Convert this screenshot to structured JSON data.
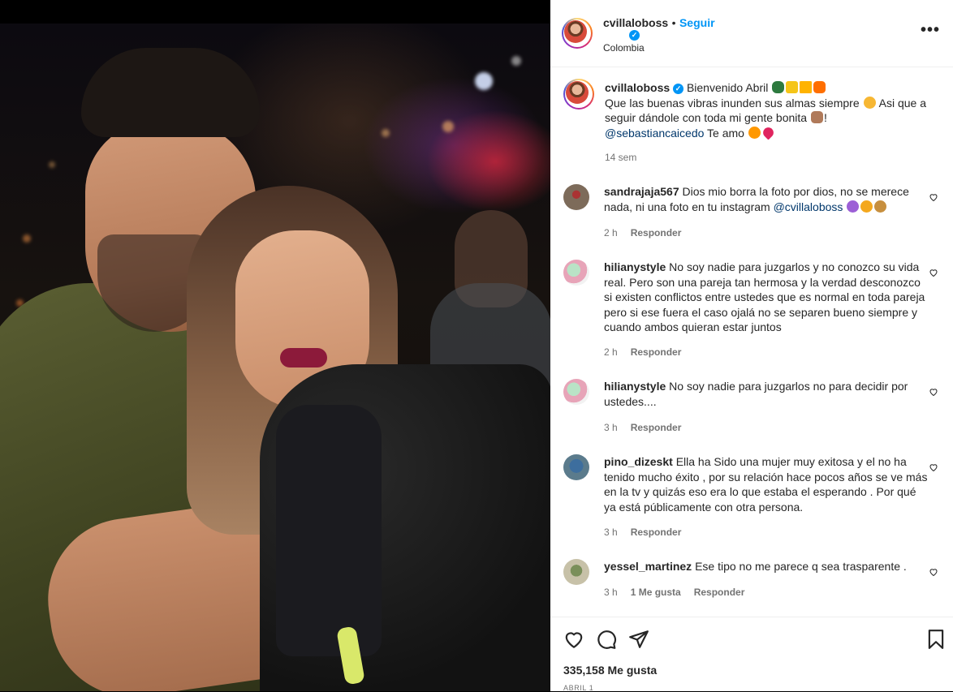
{
  "post": {
    "username": "cvillaloboss",
    "follow_label": "Seguir",
    "separator": "•",
    "location": "Colombia",
    "more_label": "•••"
  },
  "caption": {
    "username": "cvillaloboss",
    "line1": "Bienvenido Abril",
    "line2": "Que las buenas vibras inunden sus almas siempre",
    "line3": "Asi que a seguir dándole con toda mi gente bonita",
    "line4_end": "!",
    "mention": "@sebastiancaicedo",
    "ending": "Te amo",
    "time": "14 sem"
  },
  "comments": [
    {
      "username": "sandrajaja567",
      "text": "Dios mio borra la foto por dios, no se merece nada, ni una foto en tu instagram",
      "mention": "@cvillaloboss",
      "time": "2 h",
      "reply": "Responder",
      "likes": ""
    },
    {
      "username": "hilianystyle",
      "text": "No soy nadie para juzgarlos y no conozco su vida real. Pero son una pareja tan hermosa y la verdad desconozco si existen conflictos entre ustedes que es normal en toda pareja pero si ese fuera el caso ojalá no se separen bueno siempre y cuando ambos quieran estar juntos",
      "mention": "",
      "time": "2 h",
      "reply": "Responder",
      "likes": ""
    },
    {
      "username": "hilianystyle",
      "text": "No soy nadie para juzgarlos no para decidir por ustedes....",
      "mention": "",
      "time": "3 h",
      "reply": "Responder",
      "likes": ""
    },
    {
      "username": "pino_dizeskt",
      "text": "Ella ha Sido una mujer muy exitosa y el no ha tenido mucho éxito , por su relación hace pocos años se ve más en la tv y quizás eso era lo que estaba el esperando . Por qué ya está públicamente con otra persona.",
      "mention": "",
      "time": "3 h",
      "reply": "Responder",
      "likes": ""
    },
    {
      "username": "yessel_martinez",
      "text": "Ese tipo no me parece q sea trasparente .",
      "mention": "",
      "time": "3 h",
      "reply": "Responder",
      "likes": "1 Me gusta"
    }
  ],
  "footer": {
    "likes": "335,158 Me gusta",
    "date": "ABRIL 1"
  },
  "icons": [
    "heart-icon",
    "comment-icon",
    "share-icon",
    "bookmark-icon",
    "verified-icon",
    "more-icon"
  ],
  "colors": {
    "accent": "#0095f6",
    "text": "#262626",
    "muted": "#737373",
    "mention": "#00376b"
  }
}
